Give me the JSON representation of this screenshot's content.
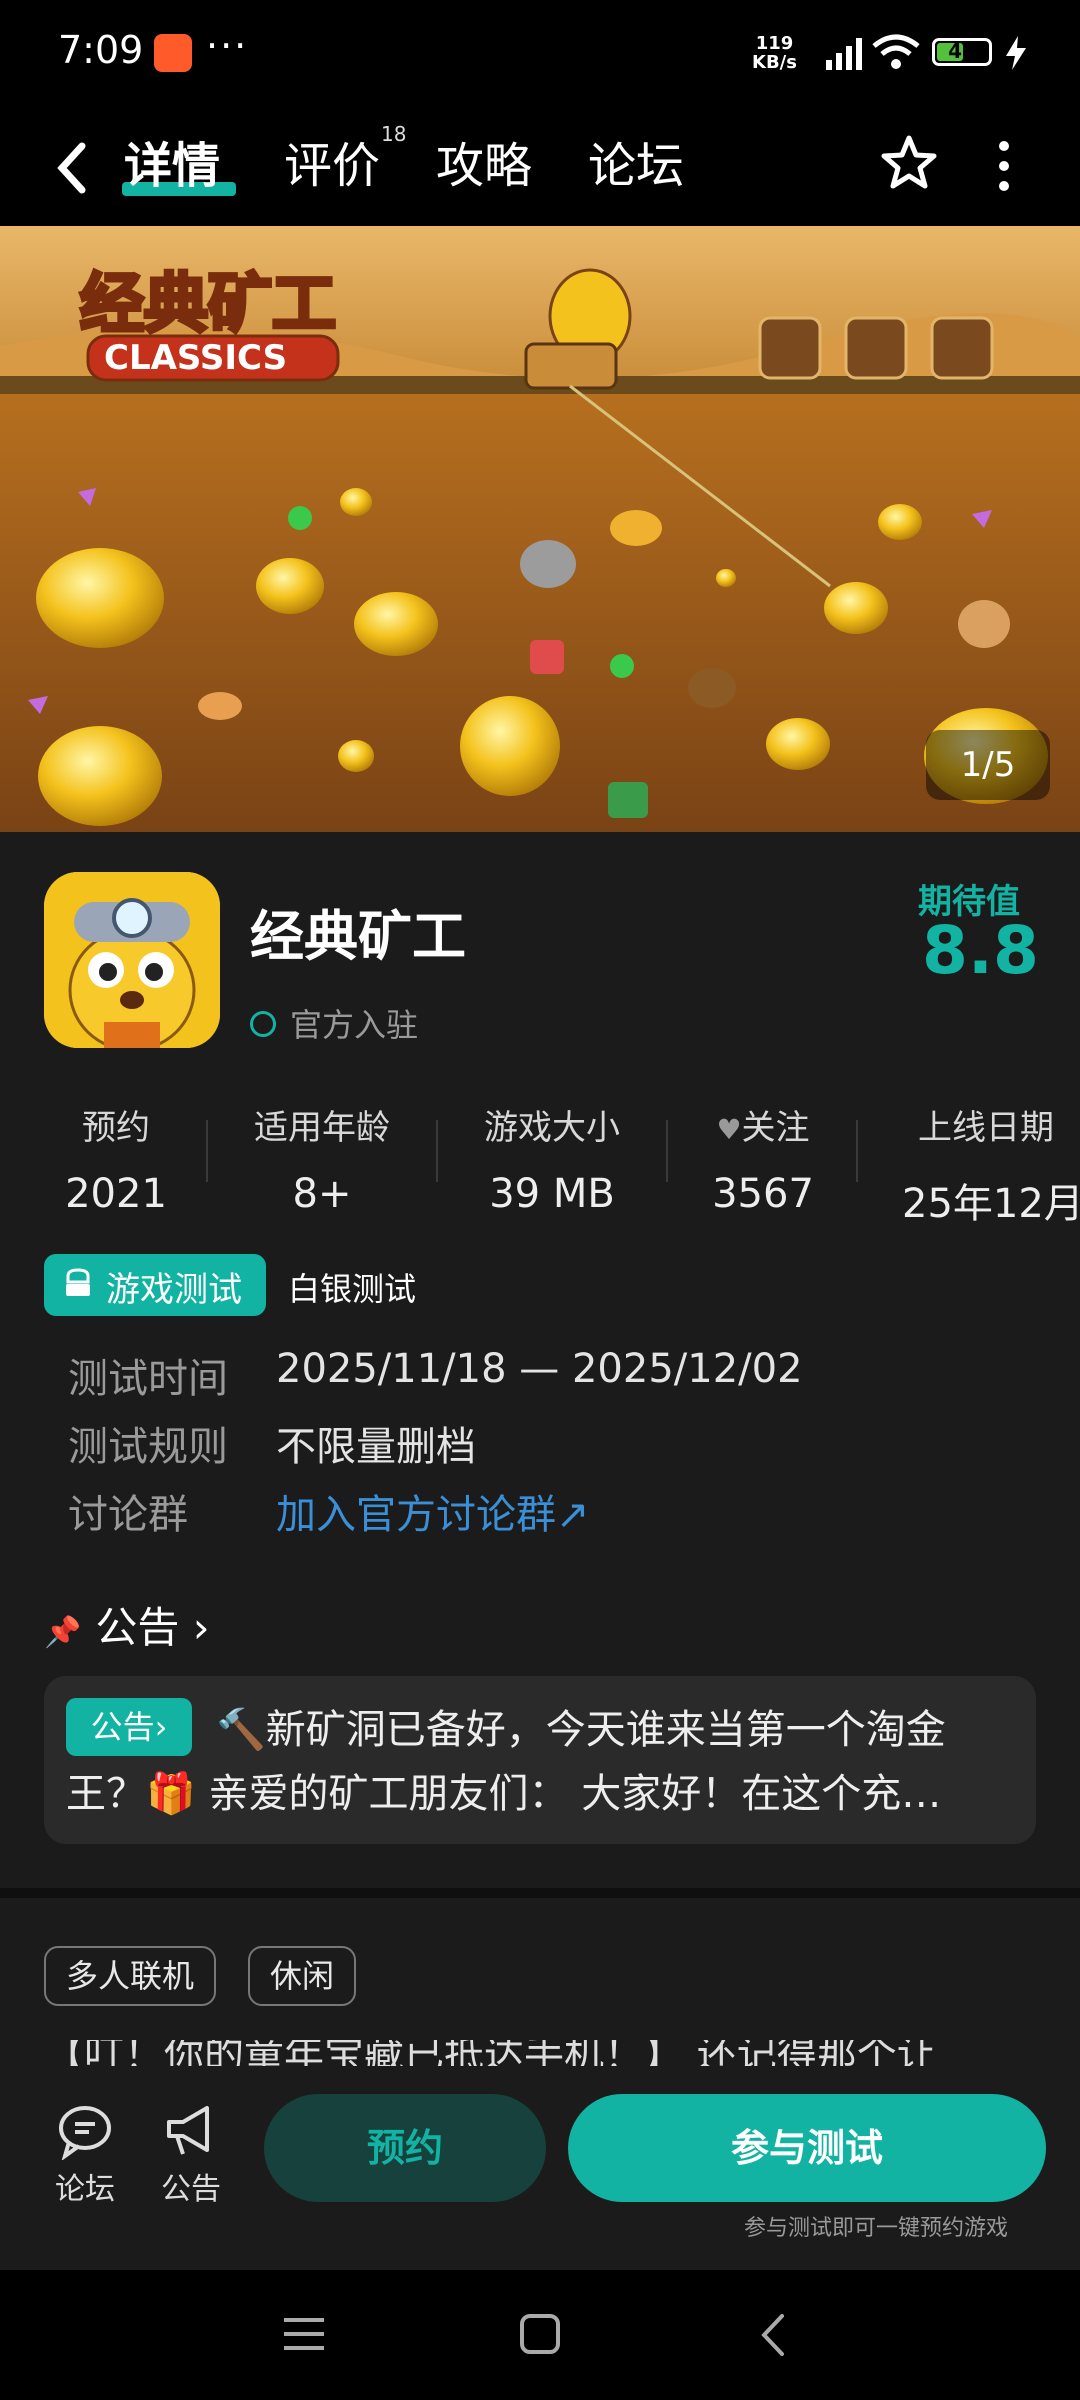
{
  "status": {
    "time": "7:09",
    "more": "···",
    "speed_top": "119",
    "speed_bottom": "KB/s",
    "battery": "49"
  },
  "nav": {
    "tabs": [
      {
        "label": "详情",
        "active": true
      },
      {
        "label": "评价",
        "badge": "18"
      },
      {
        "label": "攻略"
      },
      {
        "label": "论坛"
      }
    ]
  },
  "banner": {
    "logo_cn": "经典矿工",
    "logo_en": "CLASSICS",
    "pager": "1/5"
  },
  "app": {
    "name": "经典矿工",
    "verified": "官方入驻",
    "score_label": "期待值",
    "score": "8.8"
  },
  "stats": [
    {
      "label": "预约",
      "value": "2021"
    },
    {
      "label": "适用年龄",
      "value": "8+"
    },
    {
      "label": "游戏大小",
      "value": "39 MB"
    },
    {
      "label": "关注",
      "value": "3567"
    },
    {
      "label": "上线日期",
      "value": "25年12月"
    }
  ],
  "test": {
    "pill": "游戏测试",
    "type": "白银测试",
    "rows": [
      {
        "label": "测试时间",
        "value": "2025/11/18 — 2025/12/02"
      },
      {
        "label": "测试规则",
        "value": "不限量删档"
      },
      {
        "label": "讨论群",
        "value": "加入官方讨论群↗"
      }
    ]
  },
  "announcement": {
    "title": "公告 ›",
    "tag": "公告›",
    "text": "🔨新矿洞已备好，今天谁来当第一个淘金王？🎁 亲爱的矿工朋友们： 大家好！在这个充…"
  },
  "tags": [
    "多人联机",
    "休闲"
  ],
  "description": "【叮！你的童年宝藏已抵达手机！】 还记得那个让",
  "bottom": {
    "forum": "论坛",
    "notice": "公告",
    "reserve": "预约",
    "join": "参与测试",
    "join_hint": "参与测试即可一键预约游戏"
  },
  "colors": {
    "accent": "#12b3a3",
    "link": "#3b8fd6",
    "background": "#1b1b1b"
  }
}
